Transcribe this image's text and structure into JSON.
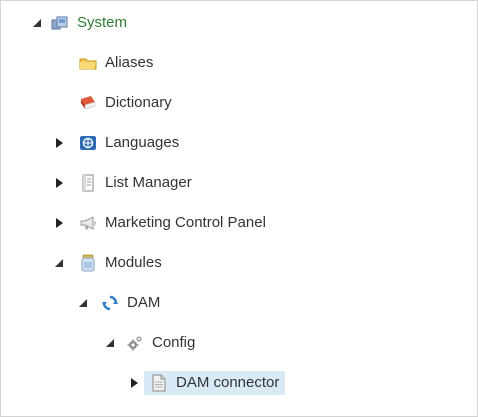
{
  "tree": {
    "items": [
      {
        "label": "System",
        "icon": "system-icon",
        "expander": "expanded"
      },
      {
        "label": "Aliases",
        "icon": "folder-icon",
        "expander": "none"
      },
      {
        "label": "Dictionary",
        "icon": "book-icon",
        "expander": "none"
      },
      {
        "label": "Languages",
        "icon": "languages-icon",
        "expander": "collapsed"
      },
      {
        "label": "List Manager",
        "icon": "list-icon",
        "expander": "collapsed"
      },
      {
        "label": "Marketing Control Panel",
        "icon": "megaphone-icon",
        "expander": "collapsed"
      },
      {
        "label": "Modules",
        "icon": "jar-icon",
        "expander": "expanded"
      },
      {
        "label": "DAM",
        "icon": "sync-icon",
        "expander": "expanded"
      },
      {
        "label": "Config",
        "icon": "gears-icon",
        "expander": "expanded"
      },
      {
        "label": "DAM connector",
        "icon": "document-icon",
        "expander": "collapsed",
        "selected": true
      }
    ]
  },
  "colors": {
    "system_text": "#2e7d32",
    "selection_bg": "#d9eaf7",
    "text": "#333333"
  }
}
